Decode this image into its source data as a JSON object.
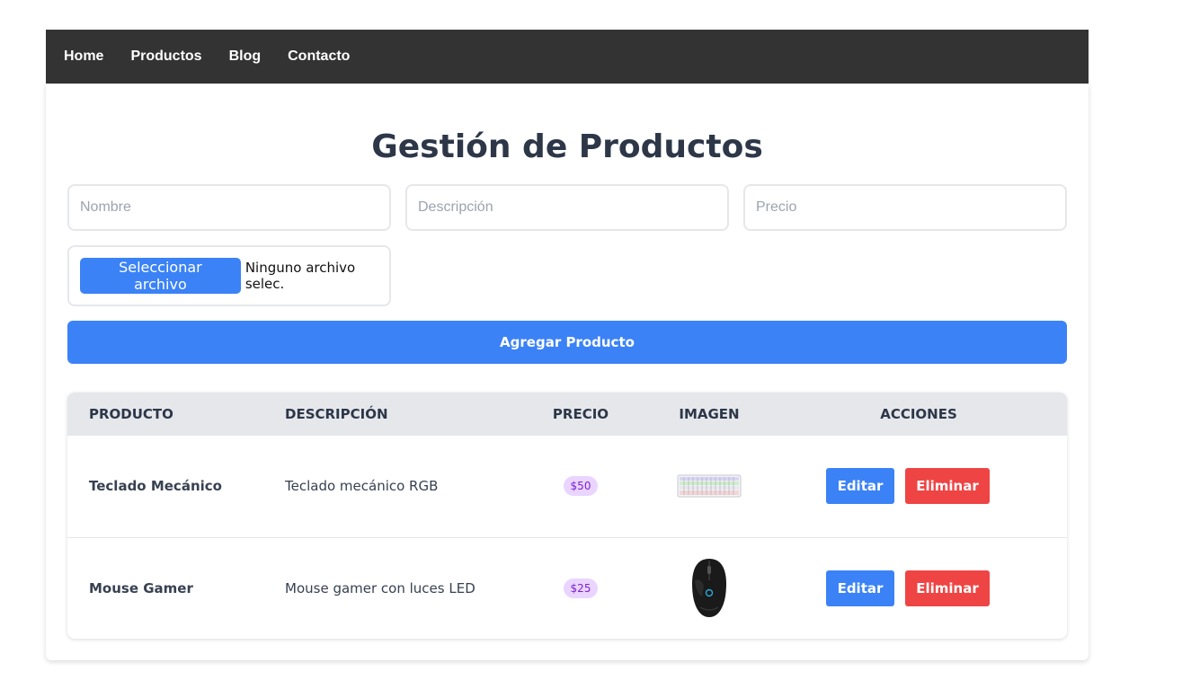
{
  "nav": {
    "items": [
      {
        "label": "Home"
      },
      {
        "label": "Productos"
      },
      {
        "label": "Blog"
      },
      {
        "label": "Contacto"
      }
    ]
  },
  "page": {
    "title": "Gestión de Productos"
  },
  "form": {
    "name_placeholder": "Nombre",
    "description_placeholder": "Descripción",
    "price_placeholder": "Precio",
    "file_button_label": "Seleccionar archivo",
    "file_status": "Ninguno archivo selec.",
    "submit_label": "Agregar Producto"
  },
  "table": {
    "headers": {
      "product": "PRODUCTO",
      "description": "DESCRIPCIÓN",
      "price": "PRECIO",
      "image": "IMAGEN",
      "actions": "ACCIONES"
    },
    "rows": [
      {
        "name": "Teclado Mecánico",
        "description": "Teclado mecánico RGB",
        "price": "$50",
        "image_icon": "keyboard-image",
        "edit_label": "Editar",
        "delete_label": "Eliminar"
      },
      {
        "name": "Mouse Gamer",
        "description": "Mouse gamer con luces LED",
        "price": "$25",
        "image_icon": "mouse-image",
        "edit_label": "Editar",
        "delete_label": "Eliminar"
      }
    ]
  },
  "colors": {
    "navbar": "#333333",
    "primary": "#3b82f6",
    "danger": "#ef4444",
    "price_badge_bg": "#e9d5ff",
    "price_badge_text": "#7e22ce"
  }
}
